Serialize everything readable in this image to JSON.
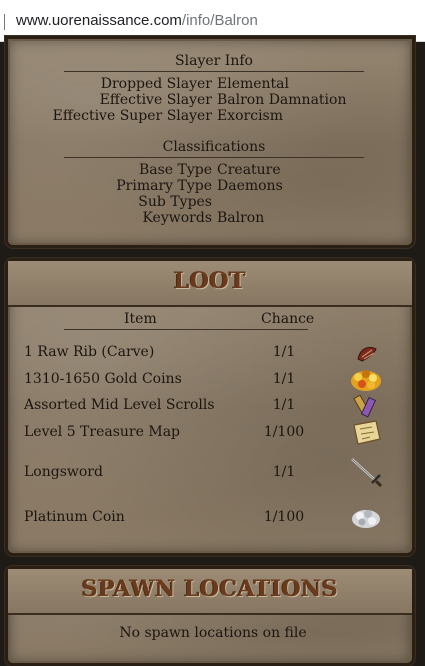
{
  "browser": {
    "url_host": "www.uorenaissance.com",
    "url_path": "/info/Balron"
  },
  "slayer": {
    "heading": "Slayer Info",
    "rows": [
      {
        "key": "Dropped Slayer",
        "value": "Elemental"
      },
      {
        "key": "Effective Slayer",
        "value": "Balron Damnation"
      },
      {
        "key": "Effective Super Slayer",
        "value": "Exorcism"
      }
    ]
  },
  "classifications": {
    "heading": "Classifications",
    "rows": [
      {
        "key": "Base Type",
        "value": "Creature"
      },
      {
        "key": "Primary Type",
        "value": "Daemons"
      },
      {
        "key": "Sub Types",
        "value": ""
      },
      {
        "key": "Keywords",
        "value": "Balron"
      }
    ]
  },
  "loot": {
    "title": "LOOT",
    "col_item": "Item",
    "col_chance": "Chance",
    "items": [
      {
        "name": "1 Raw Rib (Carve)",
        "chance": "1/1",
        "icon": "raw-rib-icon"
      },
      {
        "name": "1310-1650 Gold Coins",
        "chance": "1/1",
        "icon": "gold-coins-icon"
      },
      {
        "name": "Assorted Mid Level Scrolls",
        "chance": "1/1",
        "icon": "scrolls-icon"
      },
      {
        "name": "Level 5 Treasure Map",
        "chance": "1/100",
        "icon": "treasure-map-icon"
      },
      {
        "name": "Longsword",
        "chance": "1/1",
        "icon": "longsword-icon"
      },
      {
        "name": "Platinum Coin",
        "chance": "1/100",
        "icon": "platinum-coin-icon"
      }
    ]
  },
  "spawn": {
    "title": "SPAWN LOCATIONS",
    "message": "No spawn locations on file"
  },
  "colors": {
    "panel": "#8a7a64",
    "banner_text": "#6a3a1c",
    "border": "#2a1f15",
    "text": "#1c1610"
  }
}
